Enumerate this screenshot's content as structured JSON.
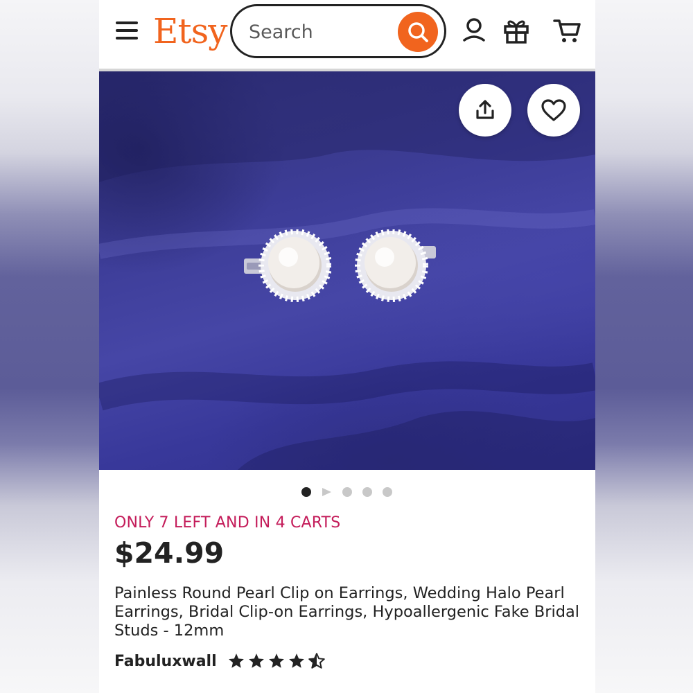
{
  "header": {
    "logo": "Etsy",
    "search_placeholder": "Search",
    "icons": [
      "menu-icon",
      "search-icon",
      "account-icon",
      "gift-icon",
      "cart-icon"
    ]
  },
  "gallery": {
    "image_alt": "Round pearl clip-on earrings with crystal halo on blue satin",
    "image_count": 5,
    "current_index": 0,
    "actions": [
      "share-icon",
      "heart-icon"
    ]
  },
  "listing": {
    "stock_notice": "ONLY 7 LEFT AND IN 4 CARTS",
    "price": "$24.99",
    "title": "Painless Round Pearl Clip on Earrings, Wedding Halo Pearl Earrings, Bridal Clip-on Earrings, Hypoallergenic Fake Bridal Studs - 12mm",
    "shop_name": "Fabuluxwall",
    "rating": 4.5
  },
  "colors": {
    "brand": "#f1641e",
    "stock_alert": "#c41c5a",
    "text": "#222222"
  }
}
